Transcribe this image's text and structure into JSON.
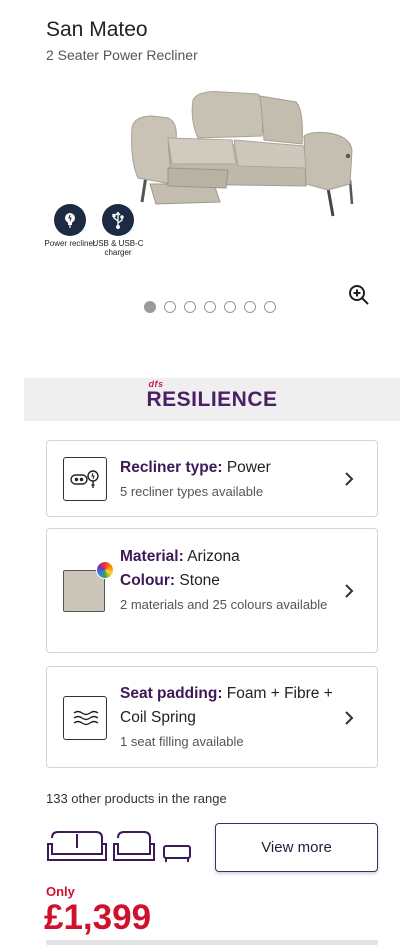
{
  "product": {
    "title": "San Mateo",
    "subtitle": "2 Seater Power Recliner"
  },
  "features": [
    {
      "icon": "power-plug-icon",
      "label": "Power recliner"
    },
    {
      "icon": "usb-icon",
      "label": "USB & USB-C charger"
    }
  ],
  "gallery": {
    "total_images": 7,
    "active_index": 0
  },
  "brand_band": {
    "prefix": "dfs",
    "name": "RESILIENCE"
  },
  "options": {
    "recliner": {
      "label": "Recliner type:",
      "value": "Power",
      "sub": "5 recliner types available",
      "icon": "recliner-power-icon"
    },
    "material": {
      "material_label": "Material:",
      "material_value": "Arizona",
      "colour_label": "Colour:",
      "colour_value": "Stone",
      "sub": "2 materials and 25 colours available",
      "icon": "fabric-swatch-icon"
    },
    "padding": {
      "label": "Seat padding:",
      "value": "Foam + Fibre + Coil Spring",
      "sub": "1 seat filling available",
      "icon": "padding-icon"
    }
  },
  "range": {
    "text": "133 other products in the range",
    "button": "View more"
  },
  "pricing": {
    "only_label": "Only",
    "price": "£1,399"
  },
  "colors": {
    "brand_purple": "#4a1f66",
    "price_red": "#d0112b",
    "feature_circle": "#1c2a44",
    "swatch_stone": "#cbc6b9"
  }
}
